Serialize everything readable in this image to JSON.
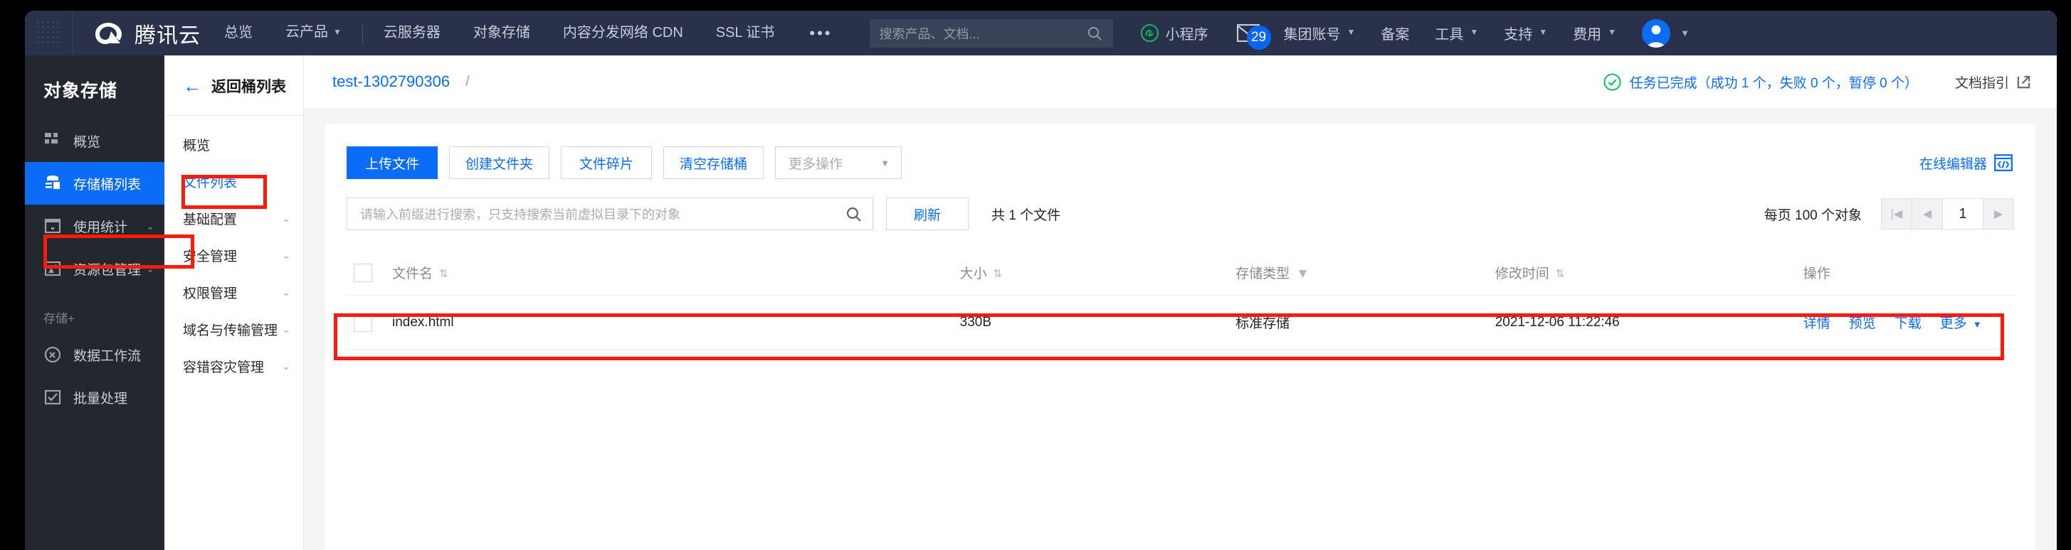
{
  "header": {
    "brand": "腾讯云",
    "nav": [
      {
        "label": "总览",
        "caret": false
      },
      {
        "label": "云产品",
        "caret": true
      },
      {
        "label": "云服务器",
        "caret": false
      },
      {
        "label": "对象存储",
        "caret": false
      },
      {
        "label": "内容分发网络 CDN",
        "caret": false
      },
      {
        "label": "SSL 证书",
        "caret": false
      }
    ],
    "more_dots": "•••",
    "search_placeholder": "搜索产品、文档...",
    "mini_program": "小程序",
    "mail_badge": "29",
    "right_nav": [
      {
        "label": "集团账号",
        "caret": true
      },
      {
        "label": "备案",
        "caret": false
      },
      {
        "label": "工具",
        "caret": true
      },
      {
        "label": "支持",
        "caret": true
      },
      {
        "label": "费用",
        "caret": true
      }
    ]
  },
  "sidebar": {
    "title": "对象存储",
    "items": [
      {
        "label": "概览",
        "icon": "grid-icon",
        "chevron": false,
        "active": false
      },
      {
        "label": "存储桶列表",
        "icon": "bucket-icon",
        "chevron": false,
        "active": true
      },
      {
        "label": "使用统计",
        "icon": "calendar-icon",
        "chevron": true,
        "active": false
      },
      {
        "label": "资源包管理",
        "icon": "package-icon",
        "chevron": true,
        "active": false
      }
    ],
    "group_label": "存储+",
    "group_items": [
      {
        "label": "数据工作流",
        "icon": "workflow-icon",
        "chevron": false
      },
      {
        "label": "批量处理",
        "icon": "batch-icon",
        "chevron": false
      }
    ]
  },
  "subnav": {
    "back_label": "返回桶列表",
    "items": [
      {
        "label": "概览",
        "chevron": false,
        "active": false
      },
      {
        "label": "文件列表",
        "chevron": false,
        "active": true
      },
      {
        "label": "基础配置",
        "chevron": true,
        "active": false
      },
      {
        "label": "安全管理",
        "chevron": true,
        "active": false
      },
      {
        "label": "权限管理",
        "chevron": true,
        "active": false
      },
      {
        "label": "域名与传输管理",
        "chevron": true,
        "active": false
      },
      {
        "label": "容错容灾管理",
        "chevron": true,
        "active": false
      }
    ]
  },
  "breadcrumb": {
    "bucket": "test-1302790306",
    "separator": "/",
    "task_status": "任务已完成（成功 1 个，失败 0 个，暂停 0 个）",
    "doc_guide": "文档指引"
  },
  "toolbar": {
    "upload_label": "上传文件",
    "create_folder_label": "创建文件夹",
    "fragments_label": "文件碎片",
    "empty_bucket_label": "清空存储桶",
    "more_ops_label": "更多操作",
    "online_editor_label": "在线编辑器"
  },
  "filter": {
    "search_placeholder": "请输入前缀进行搜索，只支持搜索当前虚拟目录下的对象",
    "refresh_label": "刷新",
    "count_text": "共 1 个文件",
    "per_page_text": "每页 100 个对象",
    "current_page": "1"
  },
  "table": {
    "columns": [
      {
        "label": "文件名",
        "sortable": true,
        "filterable": false
      },
      {
        "label": "大小",
        "sortable": true,
        "filterable": false
      },
      {
        "label": "存储类型",
        "sortable": false,
        "filterable": true
      },
      {
        "label": "修改时间",
        "sortable": true,
        "filterable": false
      },
      {
        "label": "操作",
        "sortable": false,
        "filterable": false
      }
    ],
    "rows": [
      {
        "name": "index.html",
        "size": "330B",
        "storage_type": "标准存储",
        "modified": "2021-12-06 11:22:46",
        "ops": [
          "详情",
          "预览",
          "下载",
          "更多"
        ]
      }
    ]
  },
  "colors": {
    "brand_blue": "#0b6cf5",
    "header_bg": "#29324a",
    "sidebar_bg": "#23272e",
    "highlight_red": "#ff1a0c",
    "success_green": "#0abf5b"
  }
}
